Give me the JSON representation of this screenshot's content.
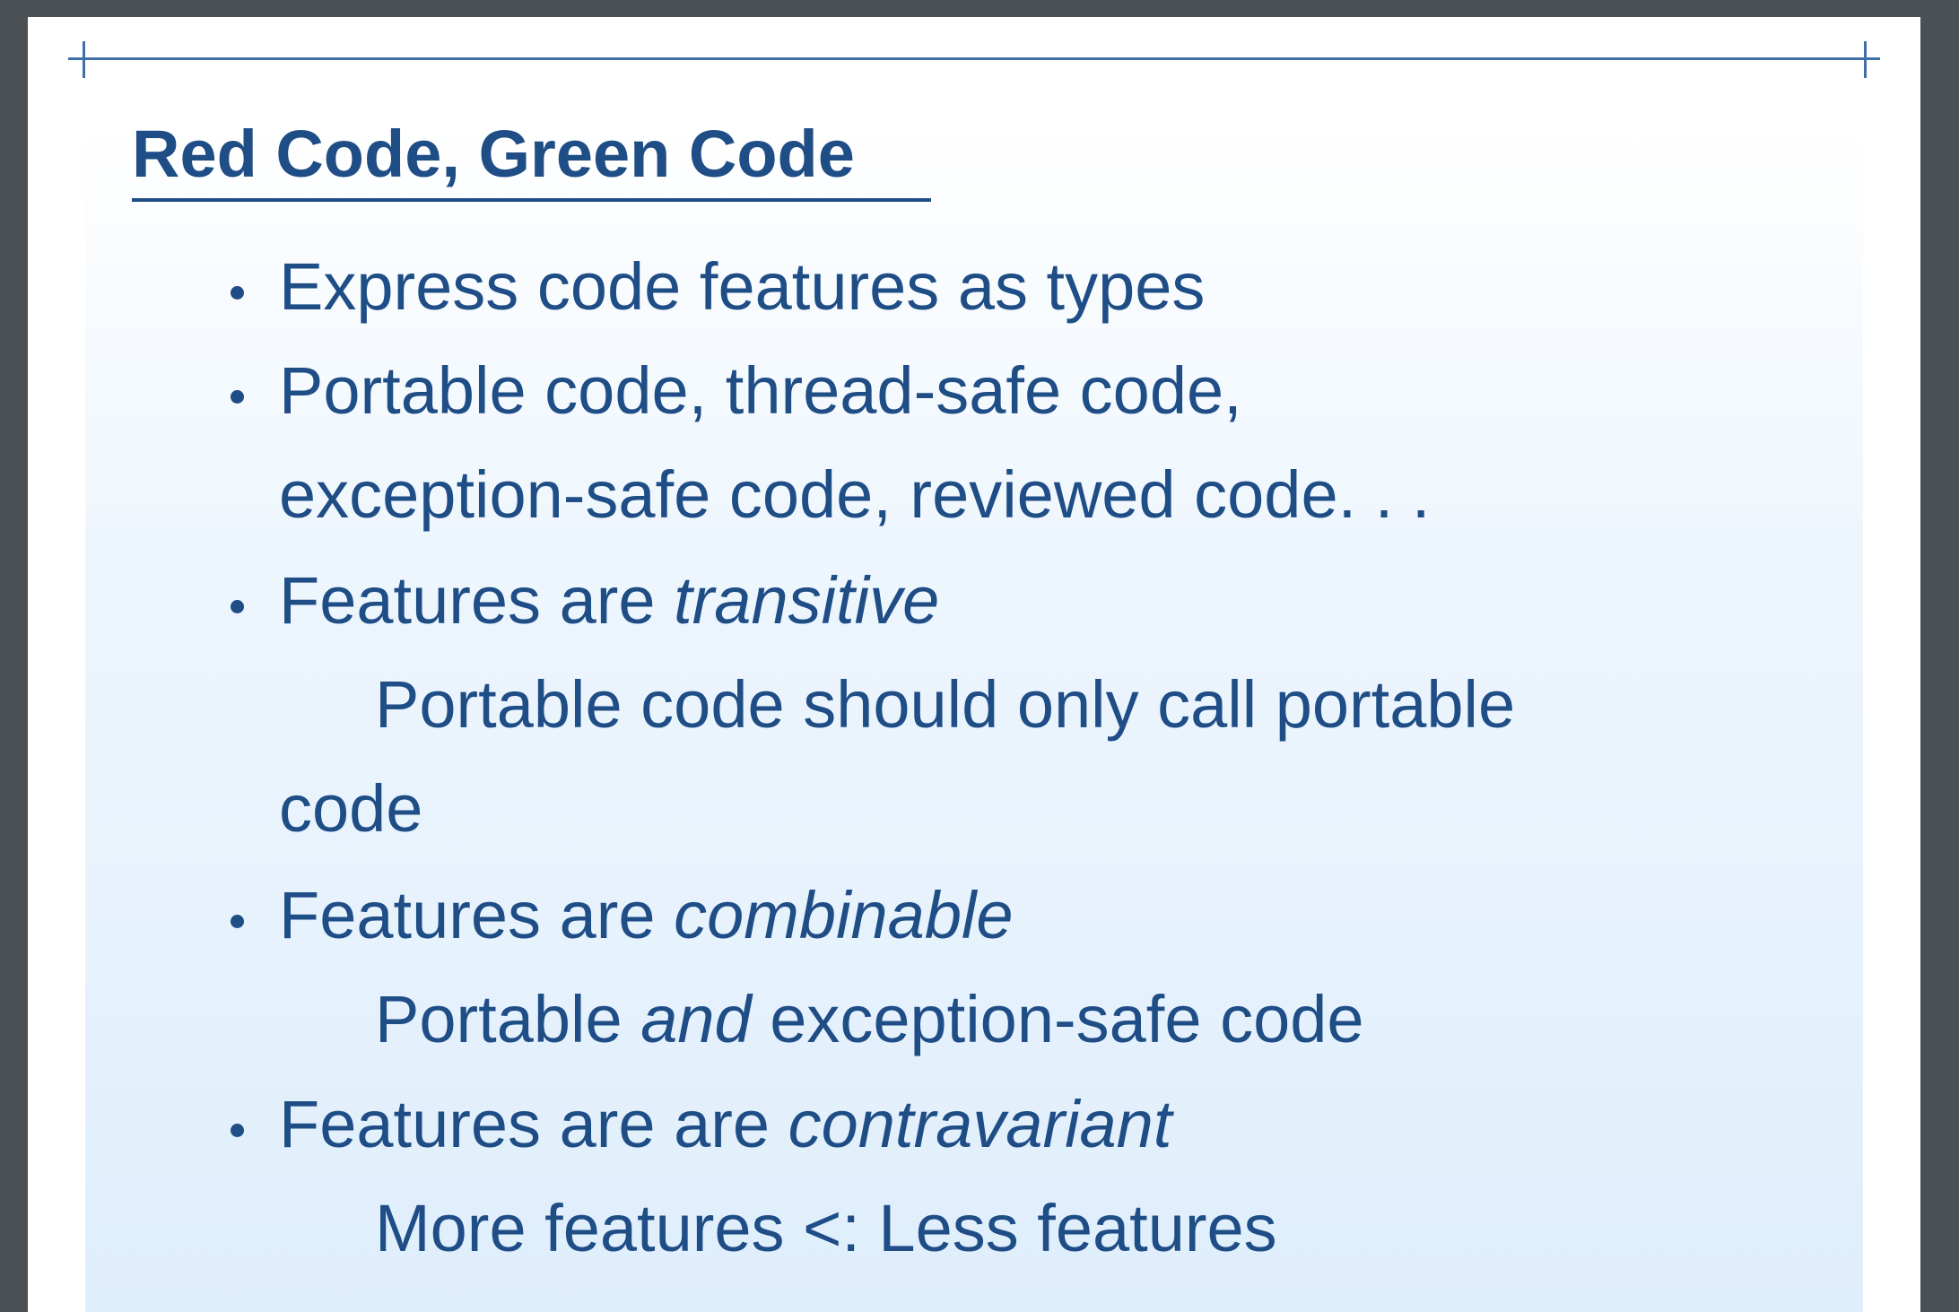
{
  "slide": {
    "title": "Red Code, Green Code",
    "bullets": [
      {
        "text": "Express code features as types"
      },
      {
        "text": "Portable code, thread-safe code,",
        "continuation": "exception-safe code, reviewed code. . ."
      },
      {
        "prefix": "Features are ",
        "emphasis": "transitive",
        "detail": "Portable code should only call portable",
        "detail_continuation": "code"
      },
      {
        "prefix": "Features are ",
        "emphasis": "combinable",
        "detail_prefix": "Portable ",
        "detail_emphasis": "and",
        "detail_suffix": " exception-safe code"
      },
      {
        "prefix": "Features are are ",
        "emphasis": "contravariant",
        "detail": "More features <: Less features"
      }
    ]
  },
  "colors": {
    "text": "#1f4d86",
    "rule": "#3f6fa6",
    "viewer_background": "#4b5055"
  }
}
